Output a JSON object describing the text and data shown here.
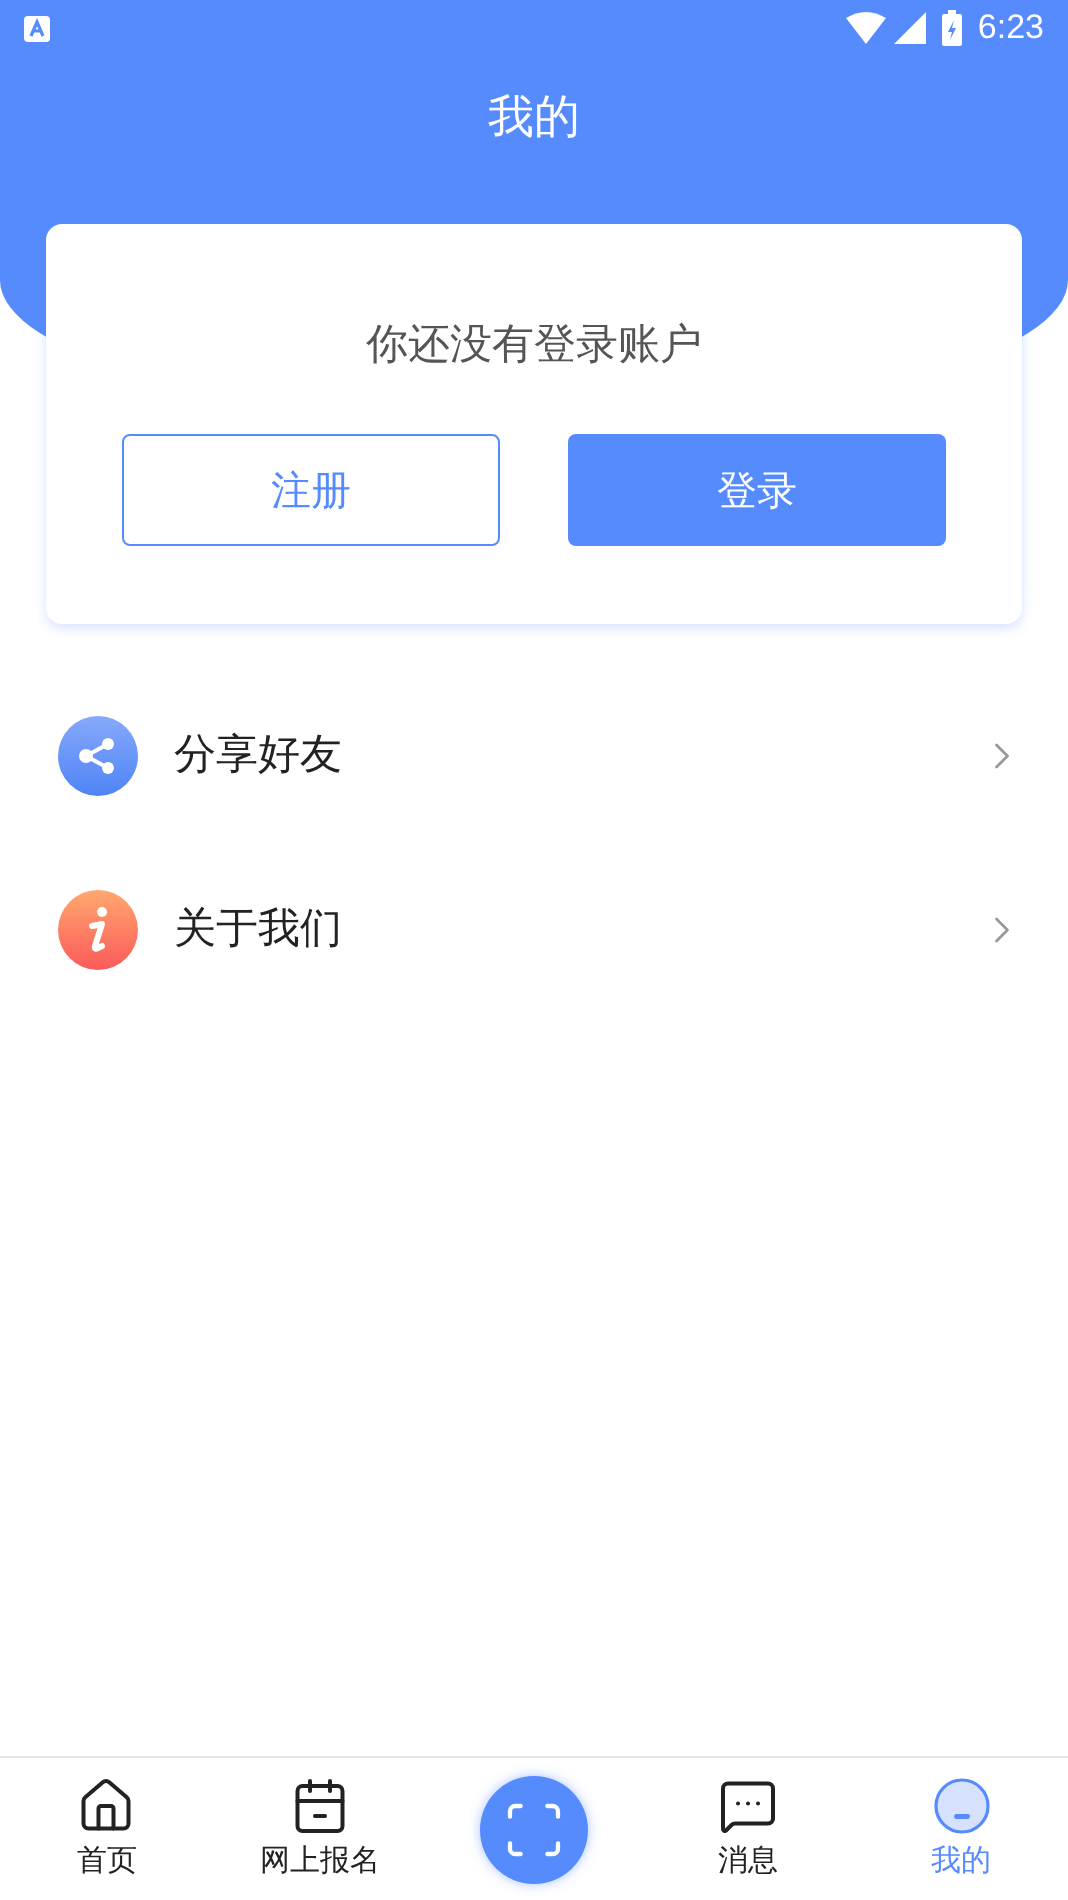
{
  "status_bar": {
    "time": "6:23"
  },
  "header": {
    "title": "我的"
  },
  "login_card": {
    "message": "你还没有登录账户",
    "buttons": [
      {
        "label": "注册",
        "kind": "outline"
      },
      {
        "label": "登录",
        "kind": "filled"
      }
    ]
  },
  "menu": [
    {
      "label": "分享好友"
    },
    {
      "label": "关于我们"
    }
  ],
  "bottom_nav": [
    {
      "label": "首页",
      "kind": "tab",
      "selected": false
    },
    {
      "label": "网上报名",
      "kind": "tab",
      "selected": false
    },
    {
      "kind": "scan",
      "selected": false
    },
    {
      "label": "消息",
      "kind": "tab",
      "selected": false
    },
    {
      "label": "我的",
      "kind": "tab",
      "selected": true
    }
  ]
}
